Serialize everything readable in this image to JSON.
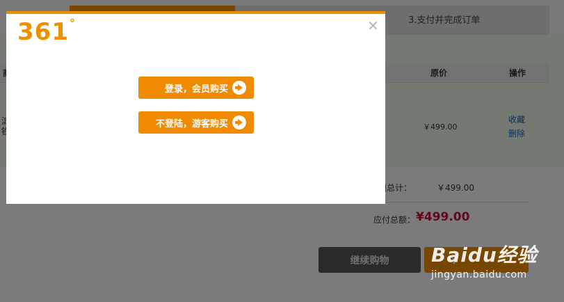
{
  "steps": {
    "step3_label": "3.支付并完成订单"
  },
  "table": {
    "col_item": "商",
    "col_price": "原价",
    "col_action": "操作"
  },
  "item": {
    "desc_fragment1": "淀",
    "desc_fragment2": "铁",
    "price": "￥499.00",
    "favorite_link": "收藏",
    "delete_link": "删除"
  },
  "summary": {
    "subtotal_label": "品金额总计：",
    "subtotal_value": "￥499.00",
    "total_label": "应付总额：",
    "total_value": "¥499.00"
  },
  "buttons": {
    "continue_shopping": "继续购物",
    "checkout": "￥"
  },
  "modal": {
    "logo_text": "361",
    "logo_degree": "°",
    "close_glyph": "✕",
    "member_button": "登录，会员购买",
    "guest_button": "不登陆，游客购买"
  },
  "watermark": {
    "brand": "Baidu经验",
    "url": "jingyan.baidu.com"
  },
  "colors": {
    "accent": "#ee8f00",
    "price_red": "#c8102e",
    "link_blue": "#1d5fae"
  }
}
